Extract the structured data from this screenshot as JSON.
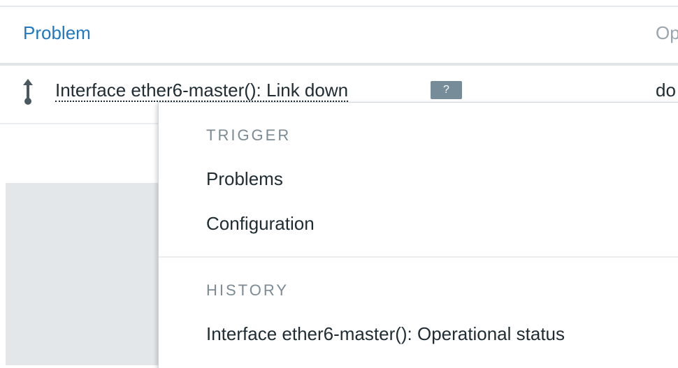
{
  "table": {
    "headers": {
      "problem": "Problem",
      "operational": "Op"
    },
    "rows": [
      {
        "severity_icon": "up-arrow-icon",
        "problem": "Interface ether6-master(): Link down",
        "help_badge": "?",
        "operational_value": "do"
      }
    ]
  },
  "context_menu": {
    "sections": [
      {
        "header": "TRIGGER",
        "items": [
          "Problems",
          "Configuration"
        ]
      },
      {
        "header": "HISTORY",
        "items": [
          "Interface ether6-master(): Operational status"
        ]
      }
    ]
  },
  "colors": {
    "link": "#1f78c1",
    "badge": "#768d99",
    "section_header": "#7b8a93",
    "overlay_gray": "#e3e7ea"
  }
}
